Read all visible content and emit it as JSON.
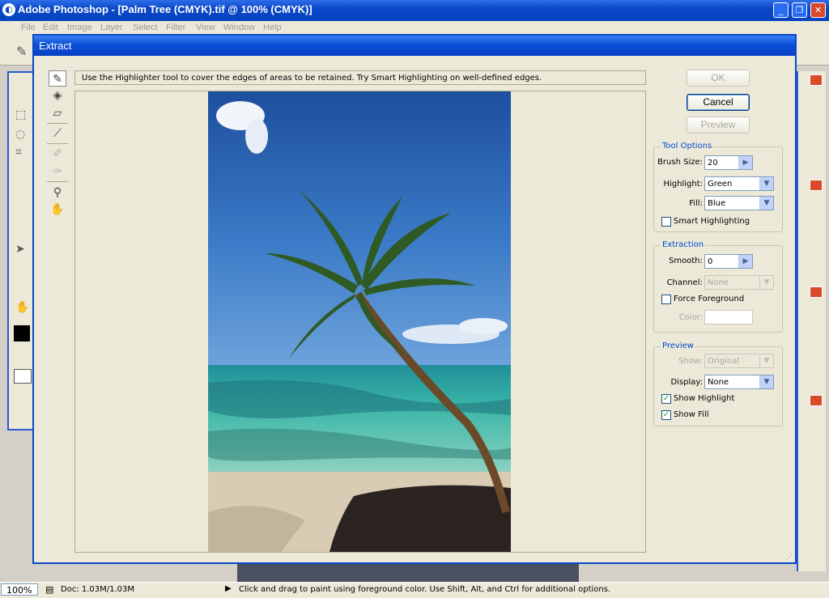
{
  "app": {
    "title": "Adobe Photoshop - [Palm Tree (CMYK).tif @ 100% (CMYK)]",
    "menu": [
      "File",
      "Edit",
      "Image",
      "Layer",
      "Select",
      "Filter",
      "View",
      "Window",
      "Help"
    ]
  },
  "dialog": {
    "title": "Extract",
    "hint": "Use the Highlighter tool to cover the edges of areas to be retained. Try Smart Highlighting on well-defined edges.",
    "buttons": {
      "ok": "OK",
      "cancel": "Cancel",
      "preview": "Preview"
    },
    "tool_options": {
      "title": "Tool Options",
      "brush_size_label": "Brush Size:",
      "brush_size": "20",
      "highlight_label": "Highlight:",
      "highlight": "Green",
      "fill_label": "Fill:",
      "fill": "Blue",
      "smart_highlighting_label": "Smart Highlighting",
      "smart_highlighting": false
    },
    "extraction": {
      "title": "Extraction",
      "smooth_label": "Smooth:",
      "smooth": "0",
      "channel_label": "Channel:",
      "channel": "None",
      "force_foreground_label": "Force Foreground",
      "force_foreground": false,
      "color_label": "Color:"
    },
    "preview": {
      "title": "Preview",
      "show_label": "Show:",
      "show": "Original",
      "display_label": "Display:",
      "display": "None",
      "show_highlight_label": "Show Highlight",
      "show_highlight": true,
      "show_fill_label": "Show Fill",
      "show_fill": true
    }
  },
  "status": {
    "zoom": "100%",
    "doc": "Doc: 1.03M/1.03M",
    "message": "Click and drag to paint using foreground color.  Use Shift, Alt, and Ctrl for additional options."
  }
}
